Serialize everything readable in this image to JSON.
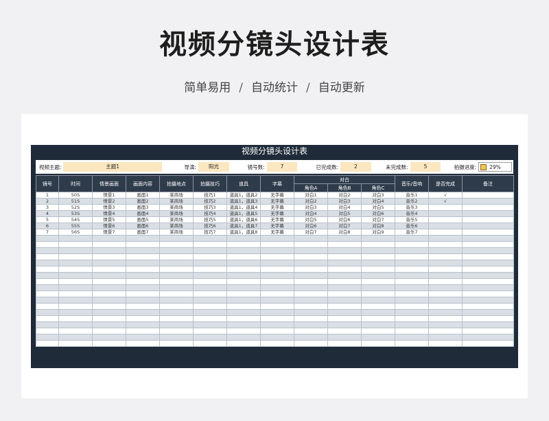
{
  "page": {
    "title": "视频分镜头设计表",
    "subtitle_parts": [
      "简单易用",
      "自动统计",
      "自动更新"
    ],
    "separator": "/"
  },
  "sheet": {
    "title": "视频分镜头设计表",
    "info": {
      "theme_label": "视频主题:",
      "theme_value": "主题1",
      "director_label": "导演:",
      "director_value": "阳光",
      "shots_label": "镜号数:",
      "shots_value": "7",
      "done_label": "已完成数:",
      "done_value": "2",
      "undone_label": "未完成数:",
      "undone_value": "5",
      "progress_label": "拍摄进度:",
      "progress_value": "29%"
    },
    "headers": {
      "shot_no": "镜号",
      "time": "时间",
      "scene": "情景画面",
      "content": "画面内容",
      "location": "拍摄地点",
      "technique": "拍摄技巧",
      "props": "道具",
      "subtitle": "字幕",
      "dialogue": "对白",
      "role_a": "角色A",
      "role_b": "角色B",
      "role_c": "角色C",
      "music": "音乐/音响",
      "done": "是否完成",
      "note": "备注"
    },
    "rows": [
      [
        "1",
        "50S",
        "情景1",
        "画面1",
        "某商场",
        "技巧1",
        "道具1，道具2",
        "无字幕",
        "对白1",
        "对白2",
        "对白3",
        "音乐1",
        "√",
        ""
      ],
      [
        "2",
        "51S",
        "情景2",
        "画面2",
        "某商场",
        "技巧2",
        "道具1，道具3",
        "无字幕",
        "对白2",
        "对白3",
        "对白4",
        "音乐2",
        "√",
        ""
      ],
      [
        "3",
        "52S",
        "情景3",
        "画面3",
        "某商场",
        "技巧3",
        "道具1，道具4",
        "无字幕",
        "对白3",
        "对白4",
        "对白5",
        "音乐3",
        "",
        ""
      ],
      [
        "4",
        "53S",
        "情景4",
        "画面4",
        "某商场",
        "技巧4",
        "道具1，道具5",
        "无字幕",
        "对白4",
        "对白5",
        "对白6",
        "音乐4",
        "",
        ""
      ],
      [
        "5",
        "54S",
        "情景5",
        "画面5",
        "某商场",
        "技巧5",
        "道具1，道具6",
        "无字幕",
        "对白5",
        "对白6",
        "对白7",
        "音乐5",
        "",
        ""
      ],
      [
        "6",
        "55S",
        "情景6",
        "画面6",
        "某商场",
        "技巧6",
        "道具1，道具7",
        "无字幕",
        "对白6",
        "对白7",
        "对白8",
        "音乐6",
        "",
        ""
      ],
      [
        "7",
        "56S",
        "情景7",
        "画面7",
        "某商场",
        "技巧7",
        "道具1，道具8",
        "无字幕",
        "对白7",
        "对白8",
        "对白9",
        "音乐7",
        "",
        ""
      ]
    ],
    "empty_rows": 18,
    "colors": {
      "frame": "#1f2b38",
      "header": "#2e3b4a",
      "highlight": "#fbe7c0",
      "stripe": "#dadfe6"
    }
  }
}
